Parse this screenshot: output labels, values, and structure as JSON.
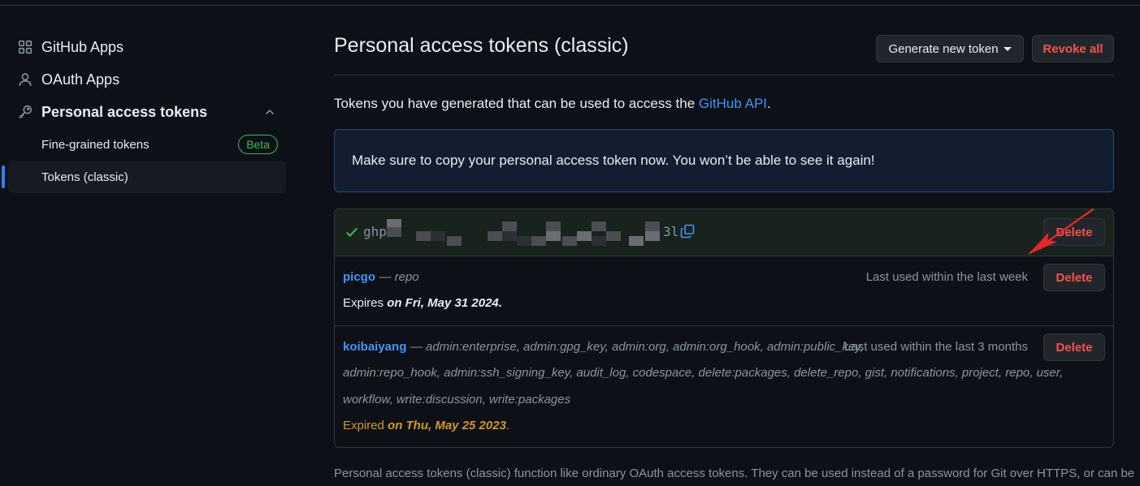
{
  "sidebar": {
    "items": [
      {
        "label": "GitHub Apps",
        "icon": "apps-icon"
      },
      {
        "label": "OAuth Apps",
        "icon": "person-icon"
      },
      {
        "label": "Personal access tokens",
        "icon": "key-icon"
      }
    ],
    "sub_items": [
      {
        "label": "Fine-grained tokens",
        "badge": "Beta"
      },
      {
        "label": "Tokens (classic)"
      }
    ]
  },
  "header": {
    "title": "Personal access tokens (classic)",
    "generate_label": "Generate new token",
    "revoke_label": "Revoke all"
  },
  "intro": {
    "text": "Tokens you have generated that can be used to access the ",
    "link": "GitHub API",
    "end": "."
  },
  "flash": {
    "message": "Make sure to copy your personal access token now. You won’t be able to see it again!"
  },
  "new_token": {
    "prefix": "ghp",
    "suffix": "3l",
    "delete_label": "Delete"
  },
  "tokens": [
    {
      "name": "picgo",
      "scopes": "repo",
      "last_used": "Last used within the last week",
      "expires_prefix": "Expires ",
      "expires_date": "on Fri, May 31 2024",
      "expires_end": ".",
      "delete_label": "Delete"
    },
    {
      "name": "koibaiyang",
      "scopes_line1": "admin:enterprise, admin:gpg_key, admin:org, admin:org_hook, admin:public_key,",
      "scopes_line2": "admin:repo_hook, admin:ssh_signing_key, audit_log, codespace, delete:packages, delete_repo, gist, notifications, project, repo, user,",
      "scopes_line3": "workflow, write:discussion, write:packages",
      "last_used": "Last used within the last 3 months",
      "expires_prefix": "Expired ",
      "expires_date": "on Thu, May 25 2023",
      "expires_end": ".",
      "delete_label": "Delete"
    }
  ],
  "footer": {
    "text": "Personal access tokens (classic) function like ordinary OAuth access tokens. They can be used instead of a password for Git over HTTPS, or can be"
  },
  "colors": {
    "accent": "#2f81f7",
    "link": "#4493f8",
    "danger": "#f85149",
    "success": "#3fb950",
    "warning": "#d29922",
    "annotation": "#e5262b"
  }
}
